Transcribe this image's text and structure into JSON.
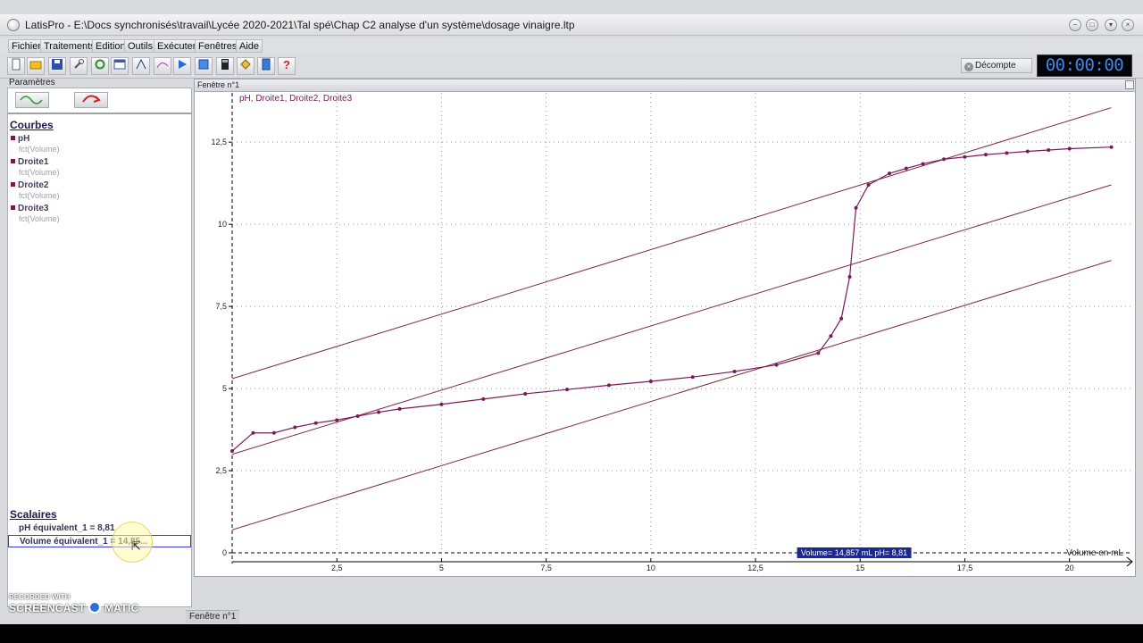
{
  "titlebar": {
    "title": "LatisPro - E:\\Docs synchronisés\\travail\\Lycée 2020-2021\\Tal spé\\Chap C2 analyse d'un système\\dosage vinaigre.ltp",
    "minimize": "−",
    "maximize": "□",
    "close": "×"
  },
  "menu": [
    "Fichier",
    "Traitements",
    "Edition",
    "Outils",
    "Exécuter",
    "Fenêtres",
    "Aide"
  ],
  "toolbar": {
    "buttons": [
      "new-file-icon",
      "open-folder-icon",
      "save-icon",
      "wrench-icon",
      "refresh-icon",
      "window-icon",
      "line-icon",
      "curve-icon",
      "play-icon",
      "export-icon",
      "calculator-icon",
      "tag-icon",
      "document-icon",
      "help-icon"
    ],
    "decompte_label": "Décompte",
    "timer": "00:00:00"
  },
  "left_panel": {
    "label": "Paramètres",
    "courbes_title": "Courbes",
    "courbes": [
      {
        "name": "pH",
        "sub": "fct(Volume)"
      },
      {
        "name": "Droite1",
        "sub": "fct(Volume)"
      },
      {
        "name": "Droite2",
        "sub": "fct(Volume)"
      },
      {
        "name": "Droite3",
        "sub": "fct(Volume)"
      }
    ],
    "scalaires_title": "Scalaires",
    "scalaires": [
      {
        "text": "pH équivalent_1 = 8,81"
      },
      {
        "text": "Volume équivalent_1 = 14,85..."
      }
    ]
  },
  "graph_window": {
    "title": "Fenêtre n°1",
    "legend": "pH, Droite1, Droite2, Droite3",
    "x_axis_label": "Volume en mL",
    "cursor_label": "Volume= 14,857 mL pH= 8,81"
  },
  "bottom": {
    "window_tab": "Fenêtre n°1",
    "watermark_top": "RECORDED WITH",
    "watermark_brand_left": "SCREENCAST",
    "watermark_brand_right": "MATIC"
  },
  "colors": {
    "curve": "#7a1a5a",
    "lines": "#7d2a3a",
    "cursor_bg": "#1d2a8c",
    "timer": "#3f86e8"
  },
  "chart_data": {
    "type": "line",
    "title": "pH, Droite1, Droite2, Droite3",
    "xlabel": "Volume en mL",
    "ylabel": "",
    "xlim": [
      0,
      21.5
    ],
    "ylim": [
      0,
      14
    ],
    "x_ticks": [
      2.5,
      5,
      7.5,
      10,
      12.5,
      15,
      17.5,
      20
    ],
    "y_ticks": [
      0,
      2.5,
      5,
      7.5,
      10,
      12.5
    ],
    "grid": true,
    "series": [
      {
        "name": "pH",
        "style": "line-markers",
        "x": [
          0,
          0.5,
          1,
          1.5,
          2,
          2.5,
          3,
          3.5,
          4,
          5,
          6,
          7,
          8,
          9,
          10,
          11,
          12,
          13,
          14,
          14.3,
          14.55,
          14.75,
          14.9,
          15.2,
          15.7,
          16.1,
          16.5,
          17,
          17.5,
          18,
          18.5,
          19,
          19.5,
          20,
          21
        ],
        "y": [
          3.1,
          3.65,
          3.65,
          3.82,
          3.95,
          4.04,
          4.16,
          4.28,
          4.38,
          4.52,
          4.68,
          4.84,
          4.97,
          5.1,
          5.22,
          5.35,
          5.52,
          5.72,
          6.08,
          6.6,
          7.13,
          8.4,
          10.5,
          11.2,
          11.55,
          11.7,
          11.84,
          11.98,
          12.05,
          12.12,
          12.17,
          12.22,
          12.26,
          12.3,
          12.35
        ]
      },
      {
        "name": "Droite1",
        "x": [
          0,
          21
        ],
        "y": [
          5.3,
          13.55
        ]
      },
      {
        "name": "Droite2",
        "x": [
          0,
          21
        ],
        "y": [
          3.0,
          11.2
        ]
      },
      {
        "name": "Droite3",
        "x": [
          0,
          21
        ],
        "y": [
          0.7,
          8.9
        ]
      }
    ],
    "cursor": {
      "x": 14.857,
      "y": 8.81
    }
  }
}
